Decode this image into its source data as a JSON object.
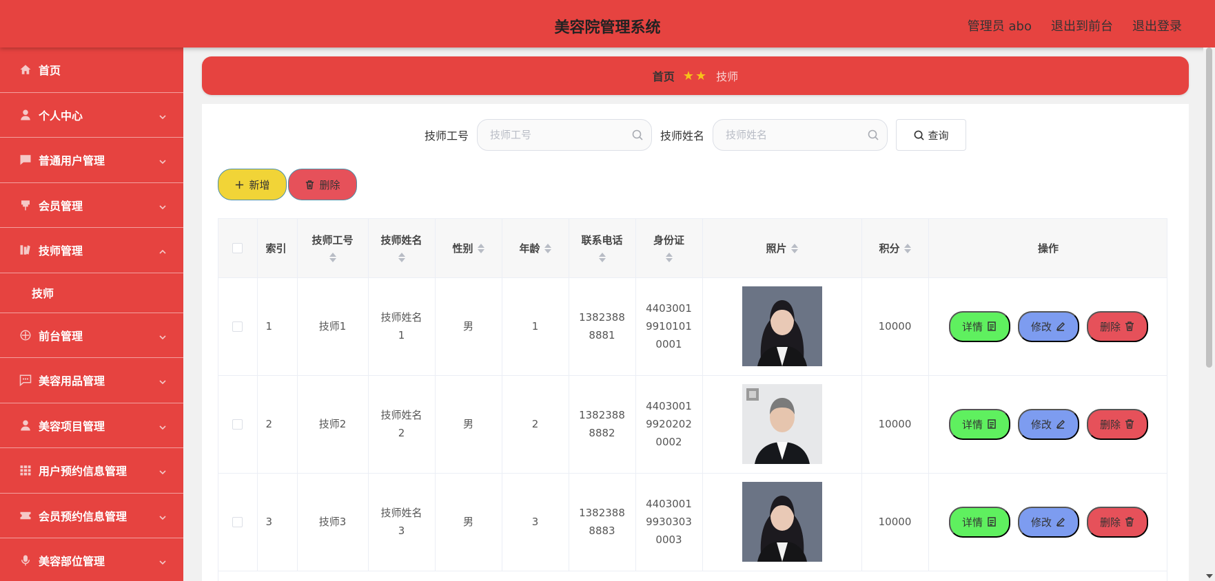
{
  "header": {
    "title": "美容院管理系统",
    "admin": "管理员 abo",
    "to_front": "退出到前台",
    "logout": "退出登录"
  },
  "sidebar": {
    "items": [
      {
        "label": "首页",
        "icon": "home-icon",
        "expandable": false
      },
      {
        "label": "个人中心",
        "icon": "user-icon",
        "expandable": true
      },
      {
        "label": "普通用户管理",
        "icon": "chat-icon",
        "expandable": true
      },
      {
        "label": "会员管理",
        "icon": "pin-icon",
        "expandable": true
      },
      {
        "label": "技师管理",
        "icon": "library-icon",
        "expandable": true,
        "expanded": true
      },
      {
        "label": "技师",
        "icon": "",
        "sub": true
      },
      {
        "label": "前台管理",
        "icon": "compass-icon",
        "expandable": true
      },
      {
        "label": "美容用品管理",
        "icon": "message-icon",
        "expandable": true
      },
      {
        "label": "美容项目管理",
        "icon": "person-icon",
        "expandable": true
      },
      {
        "label": "用户预约信息管理",
        "icon": "grid-icon",
        "expandable": true
      },
      {
        "label": "会员预约信息管理",
        "icon": "ticket-icon",
        "expandable": true
      },
      {
        "label": "美容部位管理",
        "icon": "mic-icon",
        "expandable": true
      }
    ]
  },
  "breadcrumb": {
    "home": "首页",
    "stars": "★★",
    "current": "技师"
  },
  "search": {
    "label_id": "技师工号",
    "placeholder_id": "技师工号",
    "label_name": "技师姓名",
    "placeholder_name": "技师姓名",
    "query_button": "查询"
  },
  "actions": {
    "add": "新增",
    "delete": "删除"
  },
  "table": {
    "columns": {
      "index": "索引",
      "tech_id": "技师工号",
      "tech_name": "技师姓名",
      "gender": "性别",
      "age": "年龄",
      "phone": "联系电话",
      "id_card": "身份证",
      "photo": "照片",
      "points": "积分",
      "ops": "操作"
    },
    "rows": [
      {
        "index": "1",
        "tech_id": "技师1",
        "tech_name": "技师姓名1",
        "gender": "男",
        "age": "1",
        "phone": "13823888881",
        "id_card": "440300199101010001",
        "photo": "woman",
        "points": "10000"
      },
      {
        "index": "2",
        "tech_id": "技师2",
        "tech_name": "技师姓名2",
        "gender": "男",
        "age": "2",
        "phone": "13823888882",
        "id_card": "440300199202020002",
        "photo": "man",
        "points": "10000"
      },
      {
        "index": "3",
        "tech_id": "技师3",
        "tech_name": "技师姓名3",
        "gender": "男",
        "age": "3",
        "phone": "13823888883",
        "id_card": "440300199303030003",
        "photo": "woman",
        "points": "10000"
      }
    ],
    "buttons": {
      "detail": "详情",
      "edit": "修改",
      "delete": "删除"
    }
  },
  "colors": {
    "primary": "#e64340",
    "add_button": "#f1d437",
    "delete_button": "#e6515a",
    "detail_button": "#5ff05f",
    "edit_button": "#7d9cf0",
    "star": "#f7c21a"
  }
}
